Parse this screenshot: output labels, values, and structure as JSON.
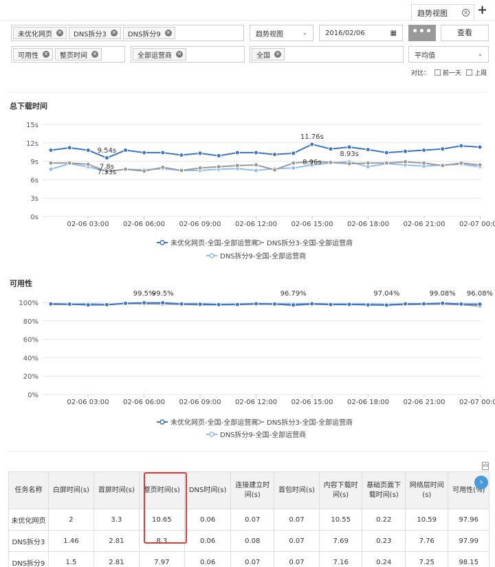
{
  "tabs": [
    {
      "label": "趋势视图"
    }
  ],
  "filters": {
    "tasks": [
      "未优化网页",
      "DNS拆分3",
      "DNS拆分9"
    ],
    "view": "趋势视图",
    "date": "2016/02/06",
    "more_label": "•••",
    "query_label": "查看",
    "metrics": [
      "可用性",
      "整页时间"
    ],
    "operators": [
      "全部运营商"
    ],
    "regions": [
      "全国"
    ],
    "aggregate": "平均值",
    "compare_label": "对比：",
    "compare_options": [
      "前一天",
      "上周"
    ]
  },
  "colors": {
    "series1": "#3a74c6",
    "series2": "#999999",
    "series3": "#8fbcf0"
  },
  "chart_data": [
    {
      "type": "line",
      "title": "总下载时间",
      "x_ticks": [
        "02-06 03:00",
        "02-06 06:00",
        "02-06 09:00",
        "02-06 12:00",
        "02-06 15:00",
        "02-06 18:00",
        "02-06 21:00",
        "02-07 00:00"
      ],
      "y_ticks": [
        "15s",
        "12s",
        "9s",
        "6s",
        "3s",
        "0s"
      ],
      "ylim": [
        0,
        15
      ],
      "grid": true,
      "legend_position": "bottom",
      "series": [
        {
          "name": "未优化网页-全国-全部运营商",
          "values": [
            10.8,
            11.2,
            10.8,
            9.54,
            10.8,
            10.4,
            10.4,
            10.0,
            10.3,
            9.9,
            10.4,
            10.4,
            10.1,
            10.3,
            11.76,
            11.0,
            11.3,
            10.9,
            10.4,
            10.6,
            10.8,
            11.0,
            11.5,
            11.3
          ]
        },
        {
          "name": "DNS拆分3-全国-全部运营商",
          "values": [
            8.7,
            8.7,
            8.5,
            7.33,
            7.7,
            7.4,
            8.0,
            7.5,
            7.9,
            8.1,
            8.3,
            8.4,
            7.6,
            8.7,
            8.96,
            8.8,
            8.6,
            8.7,
            8.7,
            8.9,
            8.7,
            8.3,
            8.7,
            8.4
          ]
        },
        {
          "name": "DNS拆分9-全国-全部运营商",
          "values": [
            7.7,
            8.6,
            8.1,
            7.33,
            7.7,
            7.6,
            7.8,
            7.5,
            7.5,
            7.7,
            7.8,
            7.5,
            7.8,
            7.9,
            8.4,
            8.7,
            8.93,
            8.1,
            8.6,
            8.4,
            8.2,
            8.4,
            8.5,
            8.1
          ]
        }
      ],
      "annotations": [
        {
          "index": 3,
          "text": "9.54s"
        },
        {
          "index": 3,
          "text": "7.33s"
        },
        {
          "index": 3,
          "text": "7.8s"
        },
        {
          "index": 14,
          "text": "11.76s"
        },
        {
          "index": 14,
          "text": "8.96s"
        },
        {
          "index": 16,
          "text": "8.93s"
        }
      ]
    },
    {
      "type": "line",
      "title": "可用性",
      "x_ticks": [
        "02-06 03:00",
        "02-06 06:00",
        "02-06 09:00",
        "02-06 12:00",
        "02-06 15:00",
        "02-06 18:00",
        "02-06 21:00",
        "02-07 00:00"
      ],
      "y_ticks": [
        "100%",
        "80%",
        "60%",
        "40%",
        "20%",
        "0%"
      ],
      "ylim": [
        0,
        100
      ],
      "grid": true,
      "legend_position": "bottom",
      "series": [
        {
          "name": "未优化网页-全国-全部运营商",
          "values": [
            98.3,
            98.1,
            97.3,
            97.5,
            99.0,
            99.5,
            99.5,
            98.3,
            98.0,
            97.6,
            97.7,
            98.5,
            98.2,
            97.2,
            98.5,
            97.7,
            97.9,
            97.3,
            97.04,
            98.4,
            98.4,
            99.08,
            98.2,
            98.1
          ]
        },
        {
          "name": "DNS拆分3-全国-全部运营商",
          "values": [
            97.8,
            97.9,
            97.6,
            97.2,
            99.1,
            98.4,
            98.2,
            97.9,
            97.4,
            97.5,
            97.8,
            98.0,
            98.1,
            96.79,
            98.0,
            97.8,
            97.6,
            97.9,
            97.1,
            97.6,
            98.0,
            98.1,
            97.5,
            96.08
          ]
        },
        {
          "name": "DNS拆分9-全国-全部运营商",
          "values": [
            98.6,
            98.0,
            98.8,
            97.9,
            98.6,
            98.7,
            98.4,
            98.4,
            98.7,
            98.0,
            98.4,
            98.6,
            98.5,
            98.6,
            98.5,
            98.5,
            98.3,
            98.4,
            98.1,
            98.1,
            98.2,
            98.6,
            98.4,
            97.6
          ]
        }
      ],
      "annotations": [
        {
          "index": 5,
          "text": "99.5%"
        },
        {
          "index": 6,
          "text": "99.5%"
        },
        {
          "index": 13,
          "text": "96.79%"
        },
        {
          "index": 18,
          "text": "97.04%"
        },
        {
          "index": 21,
          "text": "99.08%"
        },
        {
          "index": 23,
          "text": "96.08%"
        }
      ]
    }
  ],
  "table": {
    "headers": [
      "任务名称",
      "白屏时间(s)",
      "首屏时间(s)",
      "整页时间(s)",
      "DNS时间(s)",
      "连接建立时\n间(s)",
      "首包时间(s)",
      "内容下载时\n间(s)",
      "基础页面下\n载时间(s)",
      "网络层时间\n(s)",
      "可用性(%)"
    ],
    "rows": [
      [
        "未优化网页",
        "2",
        "3.3",
        "10.65",
        "0.06",
        "0.07",
        "0.07",
        "10.55",
        "0.22",
        "10.59",
        "97.96"
      ],
      [
        "DNS拆分3",
        "1.46",
        "2.81",
        "8.3",
        "0.06",
        "0.08",
        "0.07",
        "7.69",
        "0.23",
        "7.76",
        "97.99"
      ],
      [
        "DNS拆分9",
        "1.5",
        "2.81",
        "7.97",
        "0.06",
        "0.07",
        "0.07",
        "7.16",
        "0.24",
        "7.25",
        "98.15"
      ]
    ]
  }
}
